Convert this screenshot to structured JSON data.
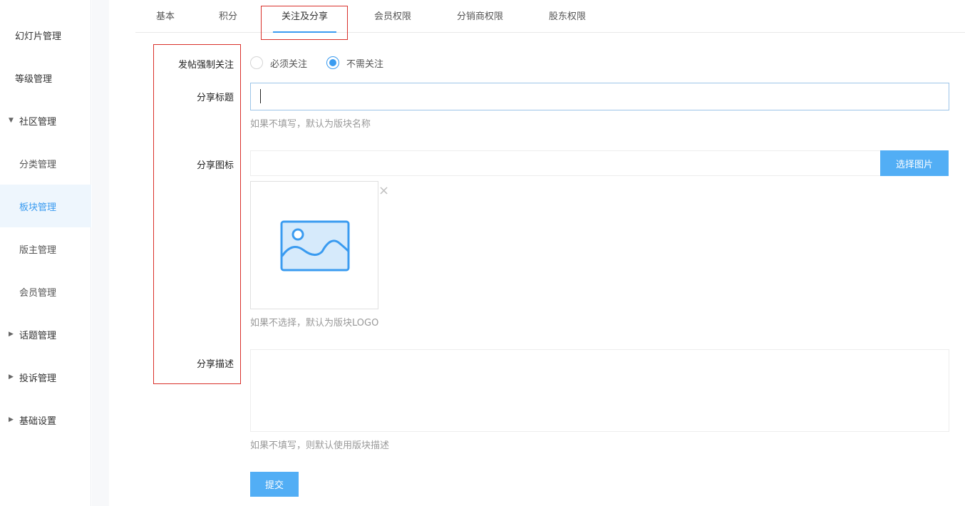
{
  "sidebar": {
    "items": [
      {
        "label": "幻灯片管理"
      },
      {
        "label": "等级管理"
      },
      {
        "label": "社区管理"
      },
      {
        "label": "分类管理"
      },
      {
        "label": "板块管理"
      },
      {
        "label": "版主管理"
      },
      {
        "label": "会员管理"
      },
      {
        "label": "话题管理"
      },
      {
        "label": "投诉管理"
      },
      {
        "label": "基础设置"
      }
    ]
  },
  "tabs": [
    {
      "label": "基本"
    },
    {
      "label": "积分"
    },
    {
      "label": "关注及分享"
    },
    {
      "label": "会员权限"
    },
    {
      "label": "分销商权限"
    },
    {
      "label": "股东权限"
    }
  ],
  "form": {
    "follow": {
      "label": "发帖强制关注",
      "options": [
        {
          "label": "必须关注",
          "checked": false
        },
        {
          "label": "不需关注",
          "checked": true
        }
      ]
    },
    "share_title": {
      "label": "分享标题",
      "value": "",
      "hint": "如果不填写，默认为版块名称"
    },
    "share_icon": {
      "label": "分享图标",
      "value": "",
      "button_label": "选择图片",
      "hint": "如果不选择，默认为版块LOGO",
      "remove_glyph": "×"
    },
    "share_desc": {
      "label": "分享描述",
      "value": "",
      "hint": "如果不填写，则默认使用版块描述"
    },
    "submit_label": "提交"
  },
  "colors": {
    "accent": "#3a9bf0",
    "button": "#52aef5",
    "highlight": "#d9302a"
  }
}
